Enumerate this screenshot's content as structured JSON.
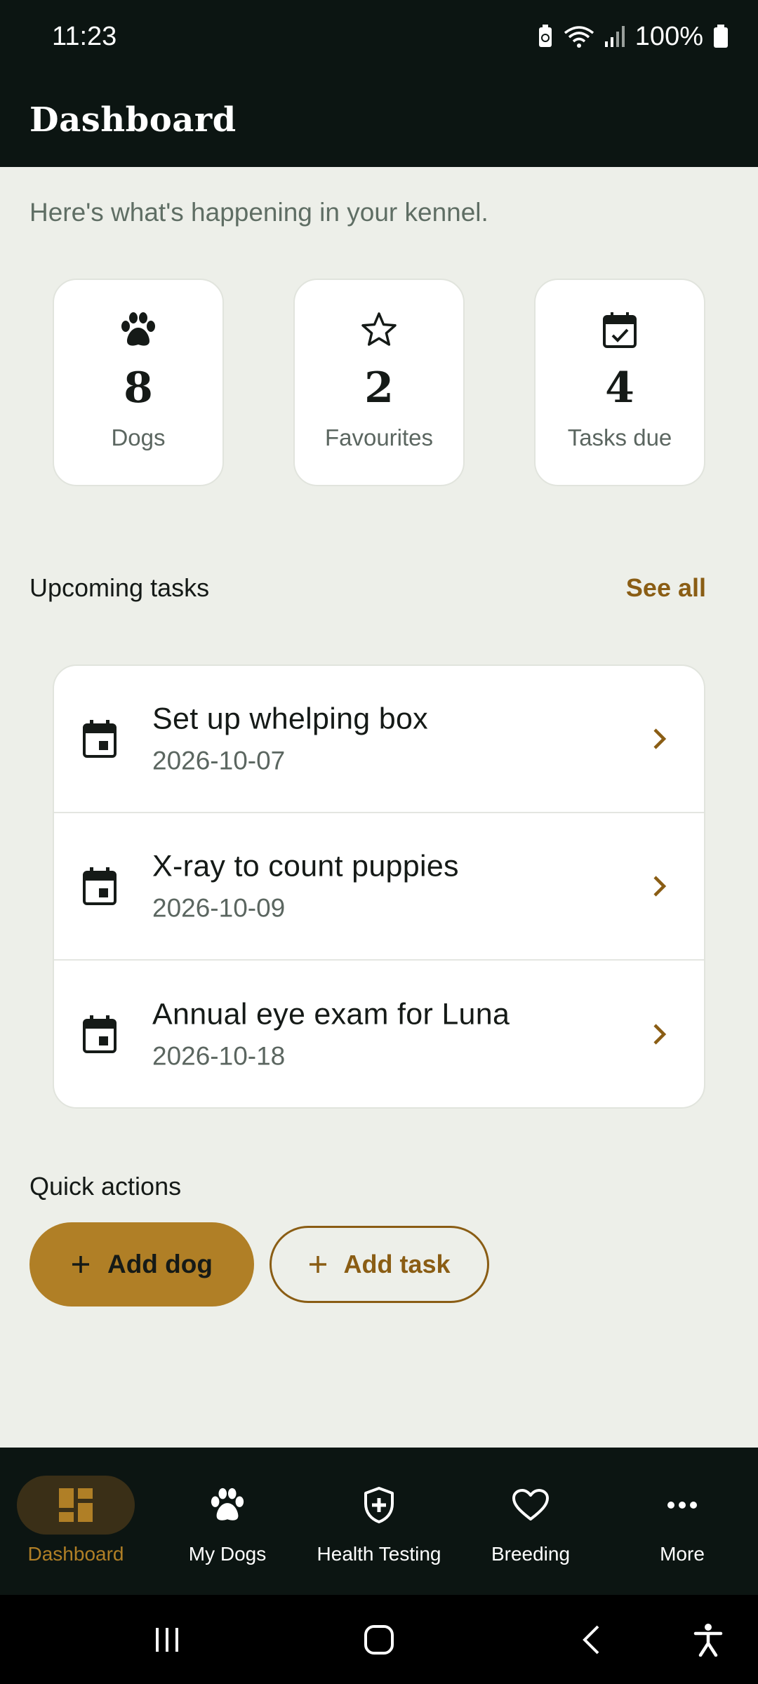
{
  "status": {
    "time": "11:23",
    "battery": "100%"
  },
  "app_bar": {
    "title": "Dashboard"
  },
  "subtitle": "Here's what's happening in your kennel.",
  "stats": [
    {
      "icon": "paw-icon",
      "value": "8",
      "label": "Dogs"
    },
    {
      "icon": "star-icon",
      "value": "2",
      "label": "Favourites"
    },
    {
      "icon": "calendar-check-icon",
      "value": "4",
      "label": "Tasks due"
    }
  ],
  "upcoming": {
    "title": "Upcoming tasks",
    "see_all": "See all",
    "tasks": [
      {
        "title": "Set up whelping box",
        "date": "2026-10-07"
      },
      {
        "title": "X-ray to count puppies",
        "date": "2026-10-09"
      },
      {
        "title": "Annual eye exam for Luna",
        "date": "2026-10-18"
      }
    ]
  },
  "quick_actions": {
    "title": "Quick actions",
    "add_dog": "Add dog",
    "add_task": "Add task"
  },
  "bottom_nav": {
    "items": [
      {
        "label": "Dashboard",
        "icon": "dashboard-icon",
        "active": true
      },
      {
        "label": "My Dogs",
        "icon": "paw-icon"
      },
      {
        "label": "Health Testing",
        "icon": "shield-plus-icon"
      },
      {
        "label": "Breeding",
        "icon": "heart-icon"
      },
      {
        "label": "More",
        "icon": "more-dots-icon"
      }
    ]
  },
  "colors": {
    "accent": "#b07f26",
    "accent_text": "#8a5d14",
    "dark": "#0c1512",
    "background": "#edefe9"
  }
}
